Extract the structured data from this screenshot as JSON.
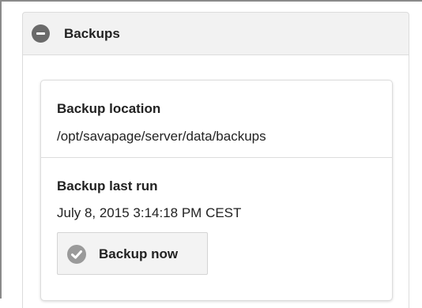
{
  "section": {
    "title": "Backups",
    "header_icon": "minus-circle-icon"
  },
  "backup": {
    "location_label": "Backup location",
    "location_value": "/opt/savapage/server/data/backups",
    "last_run_label": "Backup last run",
    "last_run_value": "July 8, 2015 3:14:18 PM CEST",
    "button_label": "Backup now",
    "button_icon": "check-circle-icon"
  },
  "colors": {
    "header_bg": "#f2f2f2",
    "icon_dark": "#6a6a6a",
    "icon_light": "#9a9a9a",
    "border": "#dddddd"
  }
}
